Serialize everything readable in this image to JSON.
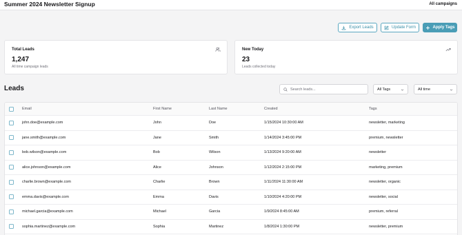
{
  "header": {
    "title": "Summer 2024 Newsletter Signup",
    "all_campaigns": "All campaigns"
  },
  "actions": {
    "export": "Export Leads",
    "update": "Update Form",
    "apply": "Apply Tags"
  },
  "stats": {
    "total": {
      "title": "Total Leads",
      "value": "1,247",
      "sub": "All time campaign leads",
      "icon": "users-icon"
    },
    "today": {
      "title": "New Today",
      "value": "23",
      "sub": "Leads collected today",
      "icon": "trending-up-icon"
    }
  },
  "leads": {
    "heading": "Leads",
    "search_placeholder": "Search leads...",
    "tag_filter": "All Tags",
    "time_filter": "All time",
    "columns": {
      "email": "Email",
      "first": "First Name",
      "last": "Last Name",
      "created": "Created",
      "tags": "Tags"
    },
    "rows": [
      {
        "email": "john.doe@example.com",
        "first": "John",
        "last": "Doe",
        "created": "1/15/2024 10:30:00 AM",
        "tags": "newsletter, marketing"
      },
      {
        "email": "jane.smith@example.com",
        "first": "Jane",
        "last": "Smith",
        "created": "1/14/2024 3:45:00 PM",
        "tags": "premium, newsletter"
      },
      {
        "email": "bob.wilson@example.com",
        "first": "Bob",
        "last": "Wilson",
        "created": "1/13/2024 9:20:00 AM",
        "tags": "newsletter"
      },
      {
        "email": "alice.johnson@example.com",
        "first": "Alice",
        "last": "Johnson",
        "created": "1/12/2024 2:15:00 PM",
        "tags": "marketing, premium"
      },
      {
        "email": "charlie.brown@example.com",
        "first": "Charlie",
        "last": "Brown",
        "created": "1/11/2024 11:30:00 AM",
        "tags": "newsletter, organic"
      },
      {
        "email": "emma.davis@example.com",
        "first": "Emma",
        "last": "Davis",
        "created": "1/10/2024 4:20:00 PM",
        "tags": "newsletter, social"
      },
      {
        "email": "michael.garcia@example.com",
        "first": "Michael",
        "last": "Garcia",
        "created": "1/9/2024 8:45:00 AM",
        "tags": "premium, referral"
      },
      {
        "email": "sophia.martinez@example.com",
        "first": "Sophia",
        "last": "Martinez",
        "created": "1/8/2024 1:30:00 PM",
        "tags": "newsletter, premium"
      }
    ]
  },
  "colors": {
    "accent": "#4a9db6",
    "accent_outline": "#5aa7c0",
    "background": "#f4f4f5"
  }
}
